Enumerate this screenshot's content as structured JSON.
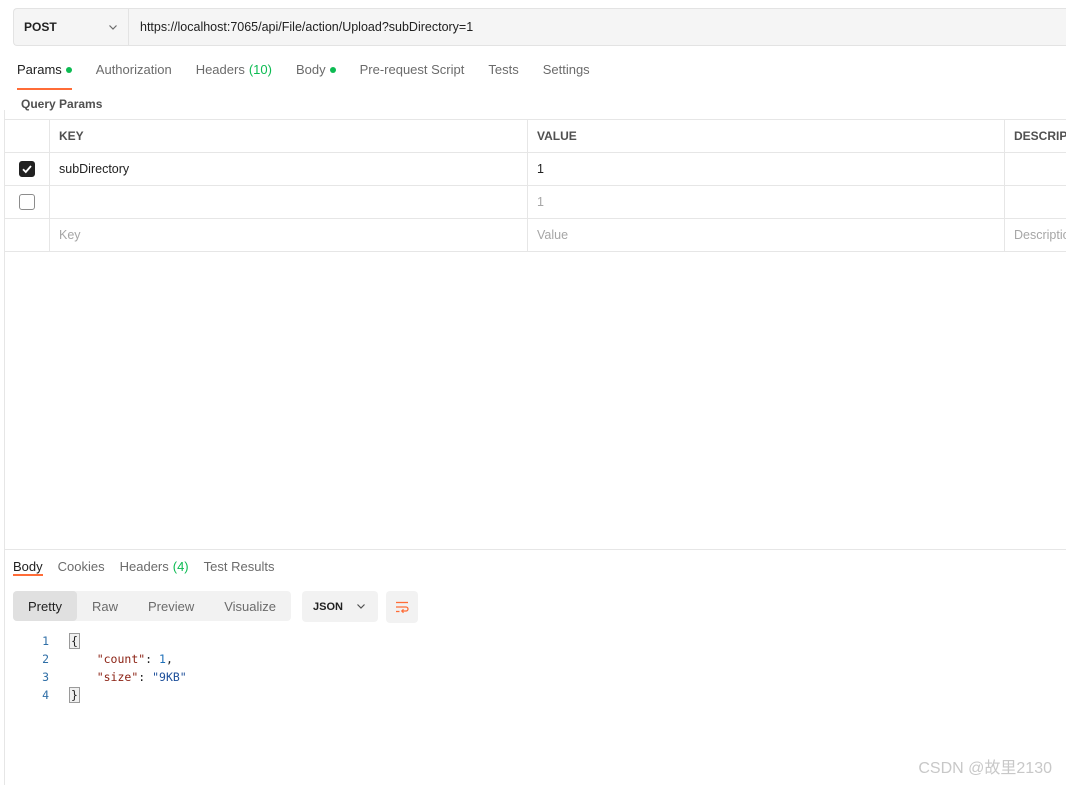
{
  "request": {
    "method": "POST",
    "url": "https://localhost:7065/api/File/action/Upload?subDirectory=1",
    "tabs": [
      {
        "label": "Params",
        "dot": true
      },
      {
        "label": "Authorization"
      },
      {
        "label": "Headers",
        "count": "(10)"
      },
      {
        "label": "Body",
        "dot": true
      },
      {
        "label": "Pre-request Script"
      },
      {
        "label": "Tests"
      },
      {
        "label": "Settings"
      }
    ],
    "active_tab": "Params"
  },
  "params": {
    "title": "Query Params",
    "columns": [
      "KEY",
      "VALUE",
      "DESCRIPTION"
    ],
    "rows": [
      {
        "checked": true,
        "key": "subDirectory",
        "value": "1",
        "description": ""
      },
      {
        "checked": false,
        "key": "",
        "value": "1",
        "description": ""
      }
    ],
    "placeholders": {
      "key": "Key",
      "value": "Value",
      "description": "Description"
    }
  },
  "response": {
    "tabs": [
      {
        "label": "Body"
      },
      {
        "label": "Cookies"
      },
      {
        "label": "Headers",
        "count": "(4)"
      },
      {
        "label": "Test Results"
      }
    ],
    "active_tab": "Body",
    "views": [
      "Pretty",
      "Raw",
      "Preview",
      "Visualize"
    ],
    "active_view": "Pretty",
    "format": "JSON",
    "lines": [
      {
        "n": "1",
        "text": "{"
      },
      {
        "n": "2",
        "key": "\"count\"",
        "value": "1",
        "suffix": ","
      },
      {
        "n": "3",
        "key": "\"size\"",
        "value": "\"9KB\"",
        "suffix": ""
      },
      {
        "n": "4",
        "text": "}"
      }
    ]
  },
  "watermark": "CSDN @故里2130",
  "colors": {
    "accent": "#ff6c37",
    "green": "#0cbb52"
  }
}
